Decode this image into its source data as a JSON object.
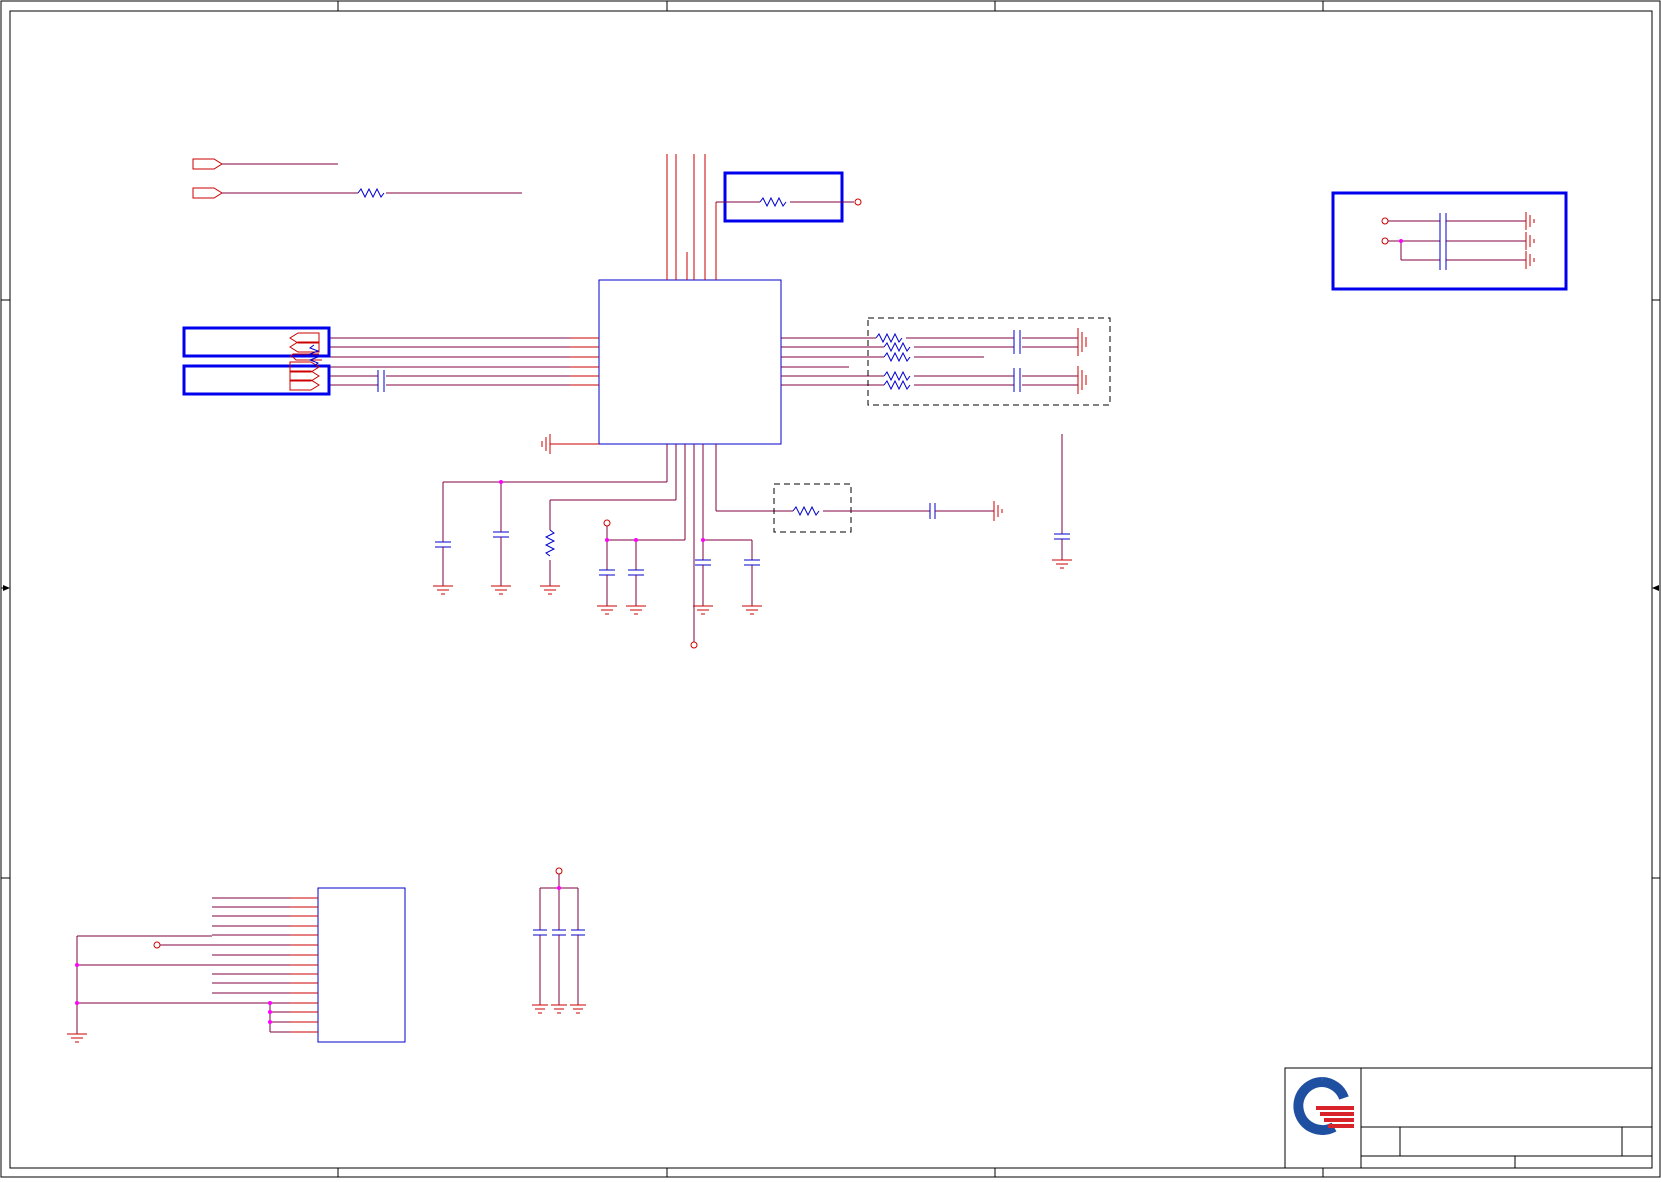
{
  "sheet": {
    "title": "",
    "colors": {
      "wire": "#cc0000",
      "net": "#800040",
      "component": "#0000cc",
      "highlight": "#0000ee",
      "junction": "#ff00ff",
      "frame": "#000000",
      "logo_blue": "#1f4fa0",
      "logo_red": "#d8232a"
    }
  },
  "title_block": {
    "logo": "company-logo"
  }
}
